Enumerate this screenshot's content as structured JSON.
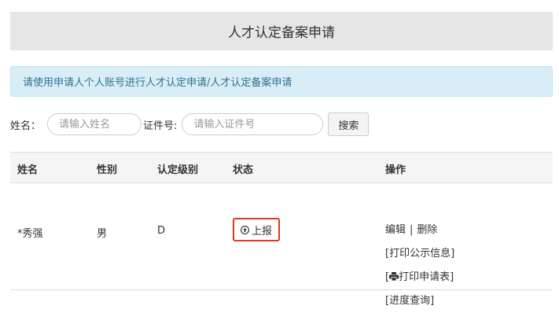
{
  "header": {
    "title": "人才认定备案申请"
  },
  "notice": {
    "text": "请使用申请人个人账号进行人才认定申请/人才认定备案申请"
  },
  "search": {
    "name_label": "姓名：",
    "name_placeholder": "请输入姓名",
    "id_label": "证件号:",
    "id_placeholder": "请输入证件号",
    "search_button": "搜索"
  },
  "table": {
    "columns": [
      "姓名",
      "性别",
      "认定级别",
      "状态",
      "操作"
    ],
    "rows": [
      {
        "name": "*秀强",
        "gender": "男",
        "level": "D",
        "status": "上报",
        "actions": {
          "edit": "编辑",
          "separator": "|",
          "delete": "删除",
          "print_public": "[打印公示信息]",
          "print_form_open": "[",
          "print_form": "打印申请表]",
          "progress": "[进度查询]"
        }
      }
    ]
  },
  "colors": {
    "header_bg": "#e6e6e6",
    "notice_bg": "#d9edf7",
    "notice_text": "#31708f",
    "highlight": "#e0391e"
  },
  "icons": {
    "status": "upload-circle-icon",
    "print": "printer-icon"
  }
}
